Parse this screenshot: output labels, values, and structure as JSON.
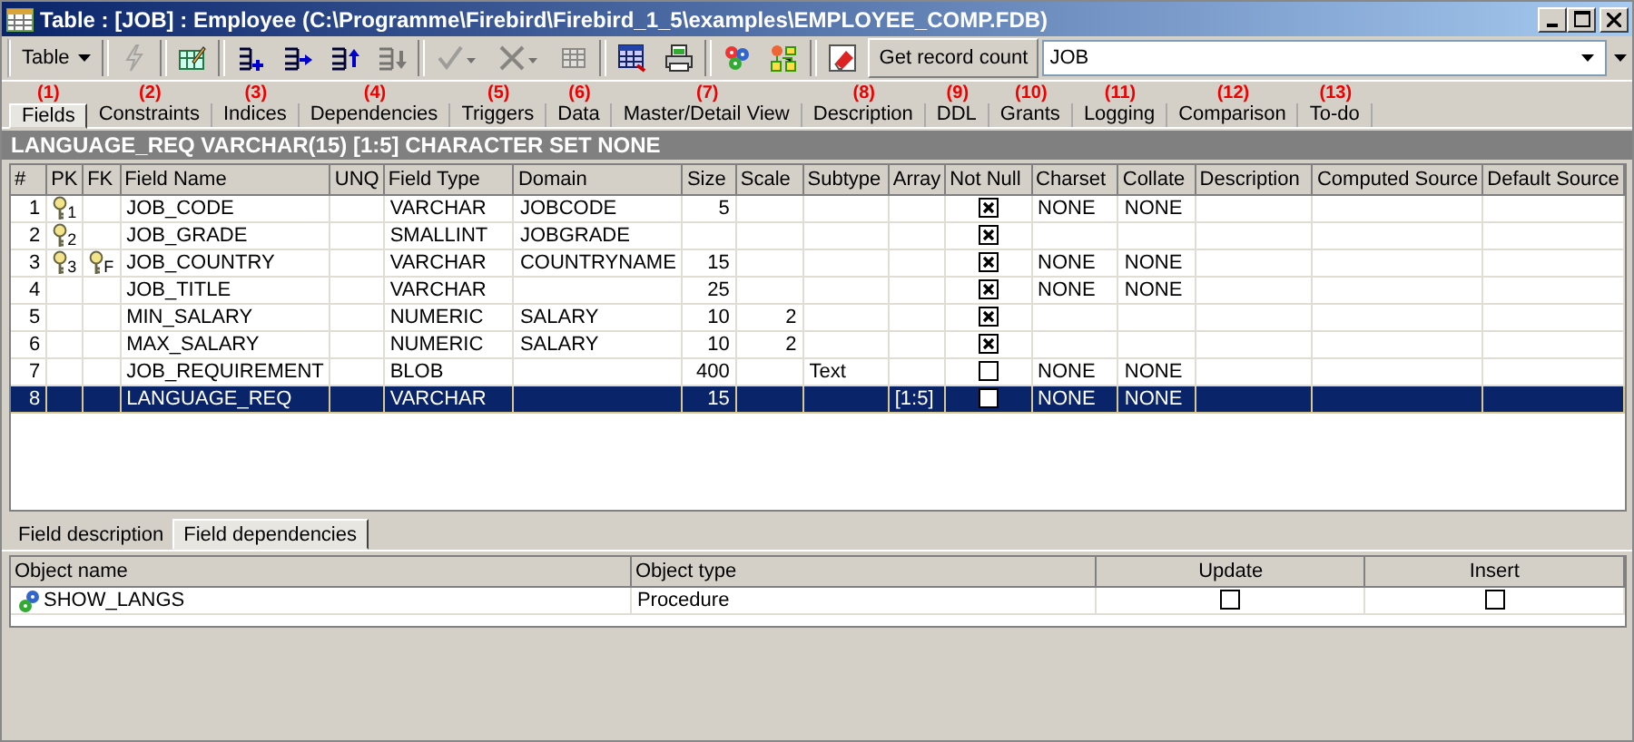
{
  "window": {
    "title": "Table : [JOB] : Employee (C:\\Programme\\Firebird\\Firebird_1_5\\examples\\EMPLOYEE_COMP.FDB)"
  },
  "toolbar": {
    "menu_label": "Table",
    "icons": [
      {
        "disabled": true
      },
      {
        "disabled": false
      },
      {
        "disabled": false
      },
      {
        "disabled": false
      },
      {
        "disabled": false
      },
      {
        "disabled": true
      },
      {
        "disabled": true
      },
      {
        "disabled": true
      },
      {
        "disabled": true
      },
      {
        "disabled": false
      },
      {
        "disabled": false
      },
      {
        "disabled": false
      },
      {
        "disabled": false
      },
      {
        "disabled": false
      }
    ],
    "record_count_button": "Get record count",
    "object_field": {
      "value": "JOB"
    }
  },
  "tabs": [
    {
      "number": "(1)",
      "label": "Fields",
      "selected": true
    },
    {
      "number": "(2)",
      "label": "Constraints",
      "selected": false
    },
    {
      "number": "(3)",
      "label": "Indices",
      "selected": false
    },
    {
      "number": "(4)",
      "label": "Dependencies",
      "selected": false
    },
    {
      "number": "(5)",
      "label": "Triggers",
      "selected": false
    },
    {
      "number": "(6)",
      "label": "Data",
      "selected": false
    },
    {
      "number": "(7)",
      "label": "Master/Detail View",
      "selected": false
    },
    {
      "number": "(8)",
      "label": "Description",
      "selected": false
    },
    {
      "number": "(9)",
      "label": "DDL",
      "selected": false
    },
    {
      "number": "(10)",
      "label": "Grants",
      "selected": false
    },
    {
      "number": "(11)",
      "label": "Logging",
      "selected": false
    },
    {
      "number": "(12)",
      "label": "Comparison",
      "selected": false
    },
    {
      "number": "(13)",
      "label": "To-do",
      "selected": false
    }
  ],
  "field_header": "LANGUAGE_REQ VARCHAR(15) [1:5] CHARACTER SET NONE",
  "fields_table": {
    "columns": [
      "#",
      "PK",
      "FK",
      "Field Name",
      "UNQ",
      "Field Type",
      "Domain",
      "Size",
      "Scale",
      "Subtype",
      "Array",
      "Not Null",
      "Charset",
      "Collate",
      "Description",
      "Computed Source",
      "Default Source"
    ],
    "rows": [
      {
        "num": "1",
        "pk": "1",
        "fk": "",
        "name": "JOB_CODE",
        "type": "VARCHAR",
        "domain": "JOBCODE",
        "size": "5",
        "scale": "",
        "subtype": "",
        "array": "",
        "not_null": true,
        "charset": "NONE",
        "collate": "NONE",
        "selected": false
      },
      {
        "num": "2",
        "pk": "2",
        "fk": "",
        "name": "JOB_GRADE",
        "type": "SMALLINT",
        "domain": "JOBGRADE",
        "size": "",
        "scale": "",
        "subtype": "",
        "array": "",
        "not_null": true,
        "charset": "",
        "collate": "",
        "selected": false
      },
      {
        "num": "3",
        "pk": "3",
        "fk": "F",
        "name": "JOB_COUNTRY",
        "type": "VARCHAR",
        "domain": "COUNTRYNAME",
        "size": "15",
        "scale": "",
        "subtype": "",
        "array": "",
        "not_null": true,
        "charset": "NONE",
        "collate": "NONE",
        "selected": false
      },
      {
        "num": "4",
        "pk": "",
        "fk": "",
        "name": "JOB_TITLE",
        "type": "VARCHAR",
        "domain": "",
        "size": "25",
        "scale": "",
        "subtype": "",
        "array": "",
        "not_null": true,
        "charset": "NONE",
        "collate": "NONE",
        "selected": false
      },
      {
        "num": "5",
        "pk": "",
        "fk": "",
        "name": "MIN_SALARY",
        "type": "NUMERIC",
        "domain": "SALARY",
        "size": "10",
        "scale": "2",
        "subtype": "",
        "array": "",
        "not_null": true,
        "charset": "",
        "collate": "",
        "selected": false
      },
      {
        "num": "6",
        "pk": "",
        "fk": "",
        "name": "MAX_SALARY",
        "type": "NUMERIC",
        "domain": "SALARY",
        "size": "10",
        "scale": "2",
        "subtype": "",
        "array": "",
        "not_null": true,
        "charset": "",
        "collate": "",
        "selected": false
      },
      {
        "num": "7",
        "pk": "",
        "fk": "",
        "name": "JOB_REQUIREMENT",
        "type": "BLOB",
        "domain": "",
        "size": "400",
        "scale": "",
        "subtype": "Text",
        "array": "",
        "not_null": false,
        "charset": "NONE",
        "collate": "NONE",
        "selected": false
      },
      {
        "num": "8",
        "pk": "",
        "fk": "",
        "name": "LANGUAGE_REQ",
        "type": "VARCHAR",
        "domain": "",
        "size": "15",
        "scale": "",
        "subtype": "",
        "array": "[1:5]",
        "not_null": false,
        "charset": "NONE",
        "collate": "NONE",
        "selected": true
      }
    ]
  },
  "lower_tabs": [
    {
      "label": "Field description",
      "selected": false
    },
    {
      "label": "Field dependencies",
      "selected": true
    }
  ],
  "dependencies_table": {
    "columns": [
      "Object name",
      "Object type",
      "Update",
      "Insert"
    ],
    "rows": [
      {
        "name": "SHOW_LANGS",
        "type": "Procedure",
        "update": false,
        "insert": false
      }
    ]
  }
}
